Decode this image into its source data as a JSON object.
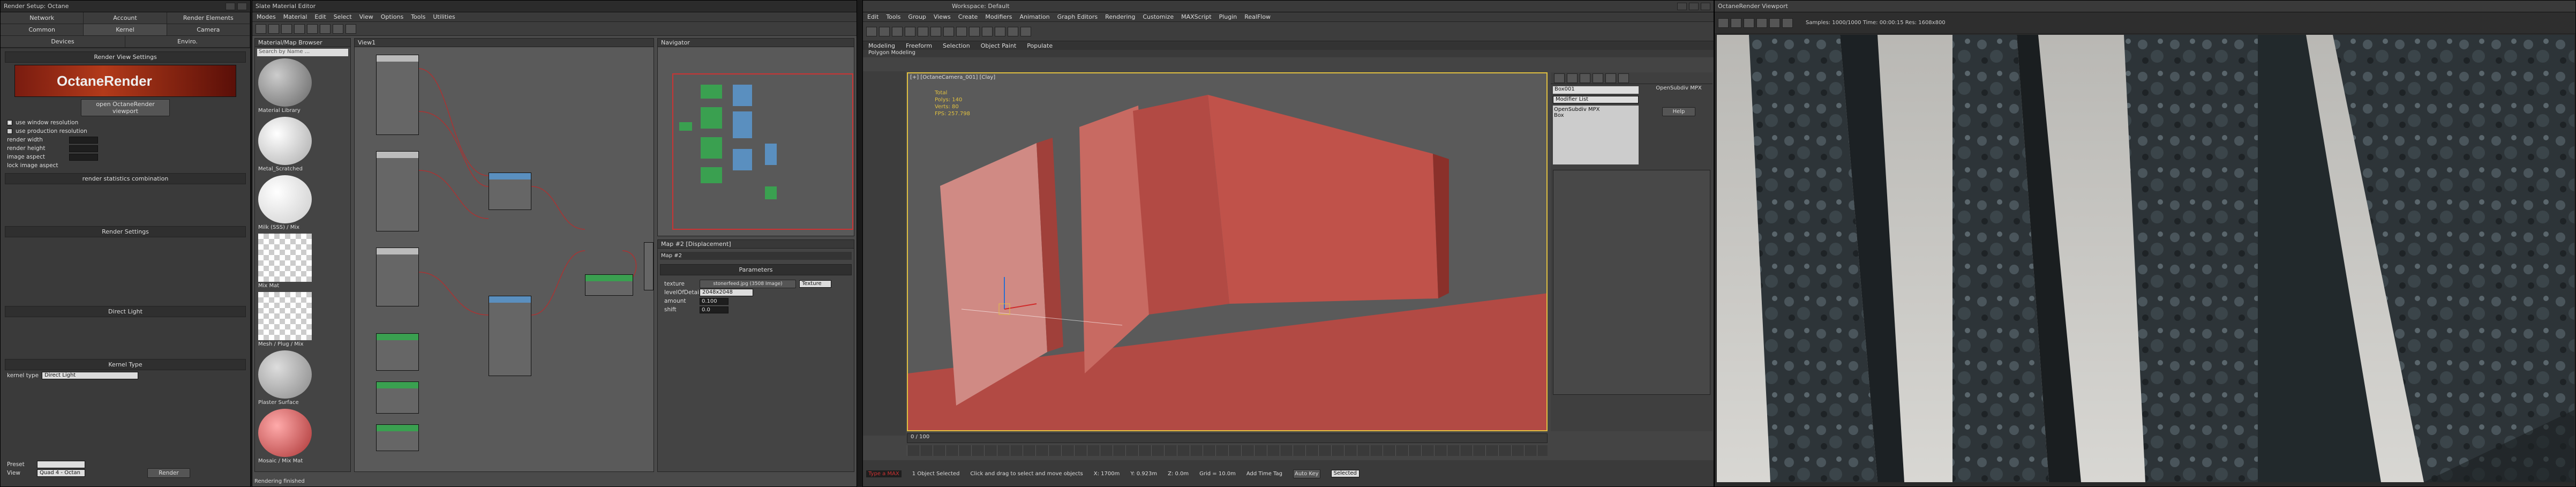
{
  "octane_settings": {
    "title": "Render Setup: Octane",
    "tabs": [
      "Network",
      "Account",
      "Render Elements",
      "Common",
      "Kernel",
      "Camera",
      "Devices",
      "Enviro."
    ],
    "render_view_header": "Render View Settings",
    "banner_logo": "OctaneRender",
    "open_viewport_btn": "open OctaneRender viewport",
    "rows": [
      "use window resolution",
      "use production resolution",
      "render width",
      "render height",
      "image aspect",
      "lock image aspect"
    ],
    "render_stats_header": "render statistics combination",
    "kernel_header": "Render Settings",
    "direct_light_header": "Direct Light",
    "kernel_type_header": "Kernel Type",
    "kernel_type_value": "Direct Light",
    "preset_label": "Preset",
    "view_label": "View",
    "view_value": "Quad 4 - Octan",
    "render_btn": "Render"
  },
  "slate": {
    "title": "Slate Material Editor",
    "menus": [
      "Modes",
      "Material",
      "Edit",
      "Select",
      "View",
      "Options",
      "Tools",
      "Utilities"
    ],
    "browser_header": "Material/Map Browser",
    "search_placeholder": "Search by Name ...",
    "view_tab": "View1",
    "navigator_header": "Navigator",
    "swatches": [
      {
        "label": "Material Library",
        "color": "#9a9a9a"
      },
      {
        "label": "Metal_Scratched",
        "color": "#d8d8d8"
      },
      {
        "label": "Milk (SSS) / Mix",
        "color": "#f0f0f0"
      },
      {
        "label": "Mix Mat",
        "color": "#bcbcbc"
      },
      {
        "label": "Mesh / Plug / Mix",
        "color": "#b0b0b0"
      },
      {
        "label": "Plaster Surface",
        "color": "#b2a6a6"
      },
      {
        "label": "Mosaic / Mix Mat",
        "color": "#ba5a5a"
      }
    ],
    "params_header": "Map #2 [Displacement]",
    "params_sub": "Map #2",
    "params_title": "Parameters",
    "texture_label": "texture",
    "texture_value": "stonerfeed.jpg (3508 Image)",
    "texture_btn": "Texture",
    "level_label": "levelOfDetail",
    "level_value": "2048x2048",
    "amount_label": "amount",
    "amount_value": "0.100",
    "shift_label": "shift",
    "shift_value": "0.0",
    "status": "Rendering finished"
  },
  "max": {
    "title": "Workspace: Default",
    "menus": [
      "Edit",
      "Tools",
      "Group",
      "Views",
      "Create",
      "Modifiers",
      "Animation",
      "Graph Editors",
      "Rendering",
      "Customize",
      "MAXScript",
      "Plugin",
      "RealFlow"
    ],
    "ribbon_tabs": [
      "Modeling",
      "Freeform",
      "Selection",
      "Object Paint",
      "Populate"
    ],
    "sub_tab": "Polygon Modeling",
    "viewport_label": "[+] [OctaneCamera_001] [Clay]",
    "stats": [
      "Total",
      "Polys: 140",
      "Verts: 80",
      "FPS: 257.798"
    ],
    "timeline": "0 / 100",
    "selection_status": "1 Object Selected",
    "hint": "Click and drag to select and move objects",
    "coord_x": "X: 1700m",
    "coord_y": "Y: 0.923m",
    "coord_z": "Z: 0.0m",
    "grid": "Grid = 10.0m",
    "add_time_tag": "Add Time Tag",
    "autokey": "Auto Key",
    "selected": "Selected",
    "modifier_list": "Modifier List",
    "plugin_name": "OpenSubdiv MPX",
    "help_btn": "Help",
    "maxscript": "Type a MAX"
  },
  "viewer": {
    "title": "OctaneRender Viewport",
    "status": "Samples: 1000/1000  Time: 00:00:15  Res: 1608x800"
  }
}
